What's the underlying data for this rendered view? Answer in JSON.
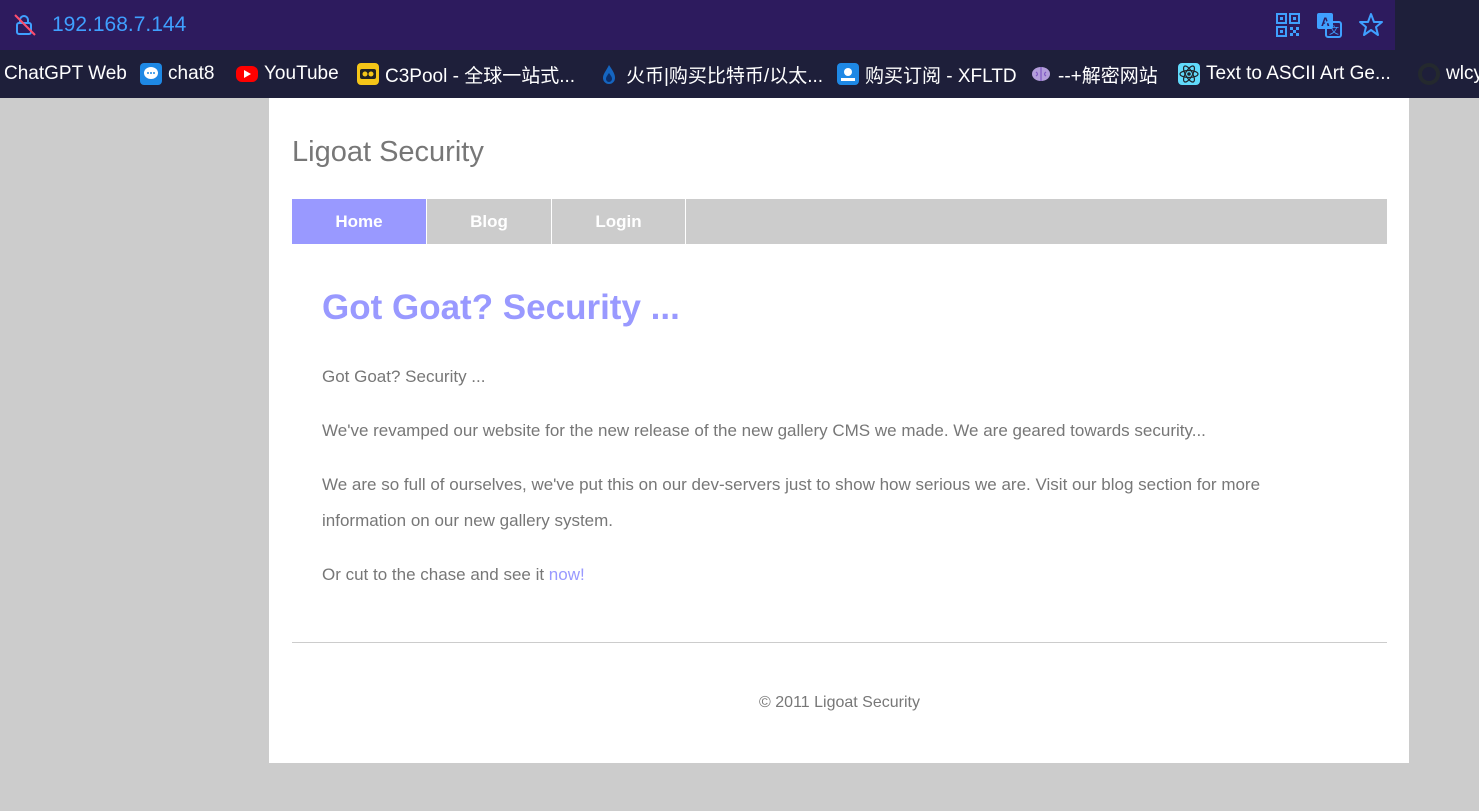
{
  "browser": {
    "url": "192.168.7.144",
    "icons": [
      "not-secure-lock-icon",
      "qr-code-icon",
      "translate-icon",
      "bookmark-star-icon"
    ],
    "bookmarks": [
      {
        "label": "ChatGPT Web",
        "icon": "none"
      },
      {
        "label": "chat8",
        "icon": "chat-bubble-icon",
        "color": "#1e88e5"
      },
      {
        "label": "YouTube",
        "icon": "youtube-icon",
        "color": "#ff0000"
      },
      {
        "label": "C3Pool - 全球一站式...",
        "icon": "c3pool-icon",
        "color": "#f5c518"
      },
      {
        "label": "火币|购买比特币/以太...",
        "icon": "huobi-flame-icon",
        "color": "#1565c0"
      },
      {
        "label": "购买订阅 - XFLTD",
        "icon": "xfltd-icon",
        "color": "#1e88e5"
      },
      {
        "label": "--+解密网站",
        "icon": "brain-icon",
        "color": "#b39ddb"
      },
      {
        "label": "Text to ASCII Art Ge...",
        "icon": "react-icon",
        "color": "#61dafb"
      },
      {
        "label": "wlcy",
        "icon": "github-icon",
        "color": "#24292e"
      }
    ]
  },
  "site": {
    "title": "Ligoat Security",
    "nav": [
      {
        "label": "Home",
        "active": true
      },
      {
        "label": "Blog",
        "active": false
      },
      {
        "label": "Login",
        "active": false
      }
    ],
    "headline": "Got Goat? Security ...",
    "paragraphs": {
      "p1": "Got Goat? Security ...",
      "p2": "We've revamped our website for the new release of the new gallery CMS we made. We are geared towards security...",
      "p3": "We are so full of ourselves, we've put this on our dev-servers just to show how serious we are. Visit our blog section for more information on our new gallery system.",
      "p4_prefix": "Or cut to the chase and see it ",
      "p4_link": "now!"
    },
    "footer": "© 2011 Ligoat Security",
    "colors": {
      "accent": "#9999ff",
      "text": "#777777",
      "nav_bg": "#cccccc"
    }
  }
}
